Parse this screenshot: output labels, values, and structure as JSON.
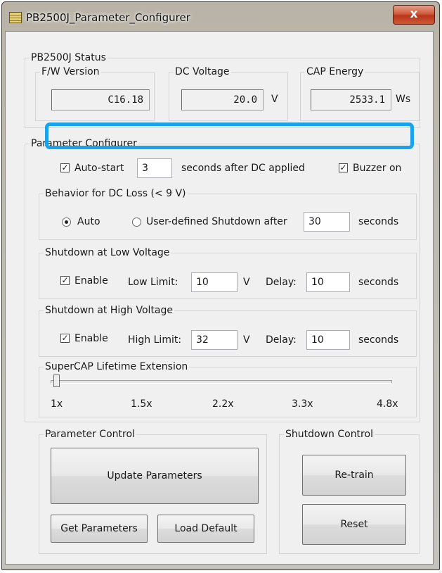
{
  "window": {
    "title": "PB2500J_Parameter_Configurer",
    "close_glyph": "x"
  },
  "status": {
    "label": "PB2500J Status",
    "fw": {
      "label": "F/W Version",
      "value": "C16.18"
    },
    "dc": {
      "label": "DC Voltage",
      "value": "20.0",
      "unit": "V"
    },
    "cap": {
      "label": "CAP Energy",
      "value": "2533.1",
      "unit": "Ws"
    }
  },
  "configurer": {
    "label": "Parameter Configurer",
    "autostart": {
      "checked": true,
      "label": "Auto-start",
      "value": "3",
      "suffix": "seconds after DC applied"
    },
    "buzzer": {
      "checked": true,
      "label": "Buzzer on"
    },
    "dc_loss": {
      "label": "Behavior for DC Loss (< 9 V)",
      "auto_label": "Auto",
      "user_label": "User-defined Shutdown after",
      "value": "30",
      "unit": "seconds",
      "selected": "Auto"
    },
    "low_voltage": {
      "label": "Shutdown at Low Voltage",
      "enable_label": "Enable",
      "checked": true,
      "limit_label": "Low Limit:",
      "limit_value": "10",
      "limit_unit": "V",
      "delay_label": "Delay:",
      "delay_value": "10",
      "delay_unit": "seconds"
    },
    "high_voltage": {
      "label": "Shutdown at High Voltage",
      "enable_label": "Enable",
      "checked": true,
      "limit_label": "High Limit:",
      "limit_value": "32",
      "limit_unit": "V",
      "delay_label": "Delay:",
      "delay_value": "10",
      "delay_unit": "seconds"
    },
    "lifetime": {
      "label": "SuperCAP Lifetime Extension",
      "ticks": [
        "1x",
        "1.5x",
        "2.2x",
        "3.3x",
        "4.8x"
      ],
      "value": "1x"
    }
  },
  "parameter_control": {
    "label": "Parameter Control",
    "update": "Update Parameters",
    "get": "Get Parameters",
    "load_default": "Load Default"
  },
  "shutdown_control": {
    "label": "Shutdown Control",
    "retrain": "Re-train",
    "reset": "Reset"
  },
  "colors": {
    "highlight": "#1aa3e8",
    "close_button": "#c8401f"
  }
}
